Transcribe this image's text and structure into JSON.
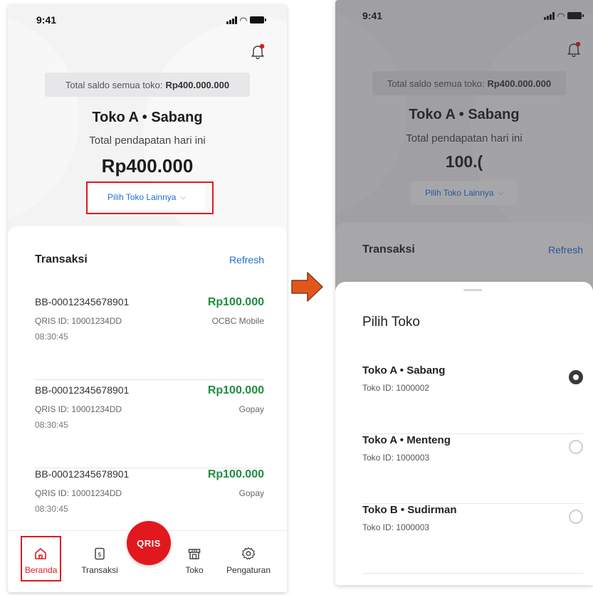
{
  "status": {
    "time": "9:41"
  },
  "home": {
    "saldo_label": "Total saldo semua toko:",
    "saldo_value": "Rp400.000.000",
    "store_name": "Toko A • Sabang",
    "income_label": "Total pendapatan hari ini",
    "income_value": "Rp400.000",
    "pick_store_label": "Pilih Toko Lainnya",
    "transactions": {
      "title": "Transaksi",
      "refresh_label": "Refresh",
      "items": [
        {
          "id": "BB-00012345678901",
          "amount": "Rp100.000",
          "qris": "QRIS ID: 10001234DD",
          "source": "OCBC Mobile",
          "time": "08:30:45"
        },
        {
          "id": "BB-00012345678901",
          "amount": "Rp100.000",
          "qris": "QRIS ID: 10001234DD",
          "source": "Gopay",
          "time": "08:30:45"
        },
        {
          "id": "BB-00012345678901",
          "amount": "Rp100.000",
          "qris": "QRIS ID: 10001234DD",
          "source": "Gopay",
          "time": "08:30:45"
        }
      ]
    },
    "nav": [
      {
        "label": "Beranda",
        "icon": "home-icon",
        "active": true
      },
      {
        "label": "Transaksi",
        "icon": "receipt-icon",
        "active": false
      },
      {
        "label": "Toko",
        "icon": "store-icon",
        "active": false
      },
      {
        "label": "Pengaturan",
        "icon": "gear-icon",
        "active": false
      }
    ],
    "qris_label": "QRIS"
  },
  "picker": {
    "background": {
      "saldo_label": "Total saldo semua toko:",
      "saldo_value": "Rp400.000.000",
      "store_name": "Toko A • Sabang",
      "income_label": "Total pendapatan hari ini",
      "income_value_partial": "100.(",
      "pick_store_label": "Pilih Toko Lainnya",
      "tx_title": "Transaksi",
      "refresh_label": "Refresh"
    },
    "title": "Pilih Toko",
    "options": [
      {
        "name": "Toko A • Sabang",
        "id": "Toko ID: 1000002",
        "selected": true
      },
      {
        "name": "Toko A • Menteng",
        "id": "Toko ID: 1000003",
        "selected": false
      },
      {
        "name": "Toko B • Sudirman",
        "id": "Toko ID: 1000003",
        "selected": false
      }
    ]
  },
  "colors": {
    "accent_red": "#e2181f",
    "link_blue": "#1d6fd8",
    "amount_green": "#1e8e3e",
    "arrow_orange": "#e2561c"
  }
}
